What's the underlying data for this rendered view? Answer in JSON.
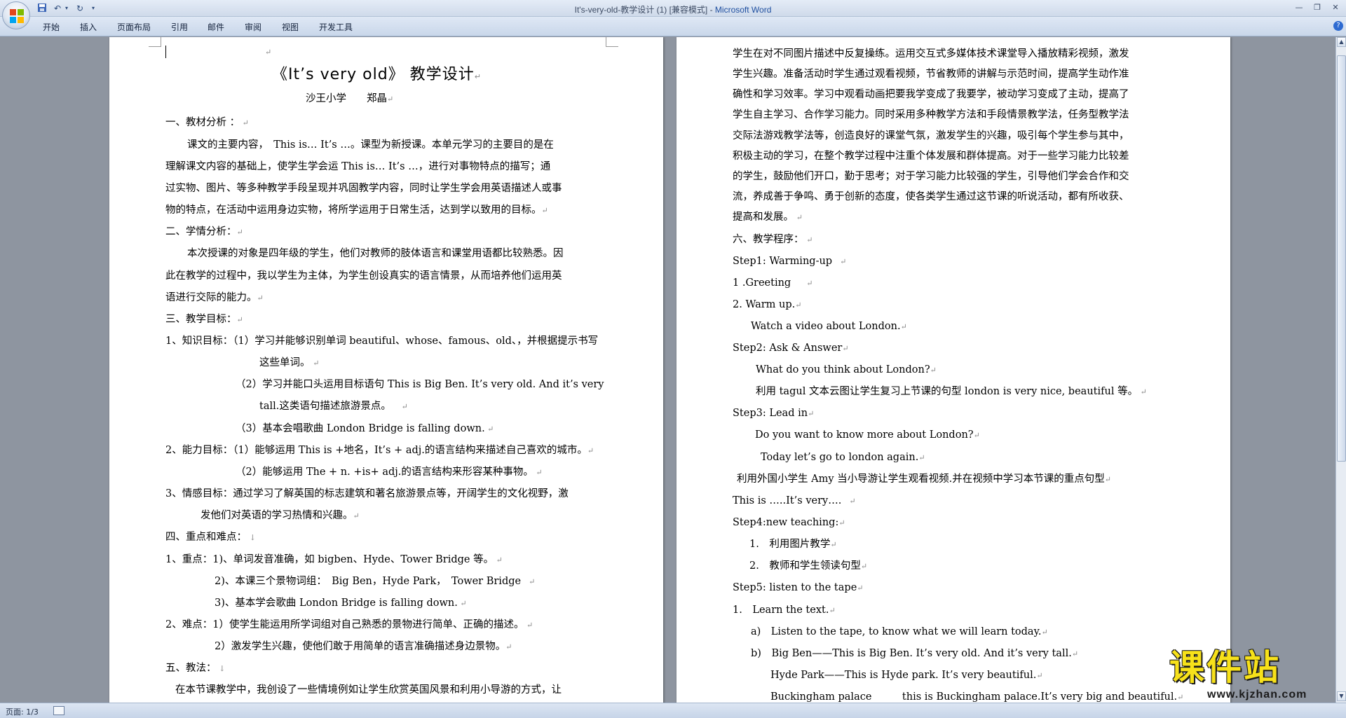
{
  "window": {
    "title": "It's-very-old-教学设计 (1) [兼容模式] - ",
    "app_name": "Microsoft Word"
  },
  "ribbon": {
    "tabs": [
      "开始",
      "插入",
      "页面布局",
      "引用",
      "邮件",
      "审阅",
      "视图",
      "开发工具"
    ]
  },
  "status": {
    "page": "页面: 1/3"
  },
  "watermark": {
    "brand": "课件站",
    "url": "www.kjzhan.com"
  },
  "left_page": {
    "title": "《It’s very old》 教学设计",
    "author": "沙王小学　　郑晶",
    "lines": [
      "一、教材分析 ：",
      "课文的主要内容，　This is… It’s …。课型为新授课。本单元学习的主要目的是在",
      "理解课文内容的基础上，使学生学会运 This is… It’s …，进行对事物特点的描写；通",
      "过实物、图片、等多种教学手段呈现并巩固教学内容，同时让学生学会用英语描述人或事",
      "物的特点，在活动中运用身边实物，将所学运用于日常生活，达到学以致用的目标。",
      "二、学情分析：",
      "本次授课的对象是四年级的学生，他们对教师的肢体语言和课堂用语都比较熟悉。因",
      "此在教学的过程中，我以学生为主体，为学生创设真实的语言情景，从而培养他们运用英",
      "语进行交际的能力。",
      "三、教学目标：",
      "1、知识目标：（1）学习并能够识别单词 beautiful、whose、famous、old、，并根据提示书写",
      "这些单词。",
      "（2）学习并能口头运用目标语句 This is Big Ben. It’s very old. And it’s very",
      "tall.这类语句描述旅游景点。",
      "（3）基本会唱歌曲 London Bridge is falling down.",
      "2、能力目标：（1）能够运用 This is +地名，It’s + adj.的语言结构来描述自己喜欢的城市。",
      "（2）能够运用 The + n. +is+ adj.的语言结构来形容某种事物。",
      "3、情感目标：通过学习了解英国的标志建筑和著名旅游景点等，开阔学生的文化视野，激",
      "发他们对英语的学习热情和兴趣。",
      "四、重点和难点：",
      "1、重点：1)、单词发音准确，如 bigben、Hyde、Tower Bridge 等。",
      "2)、本课三个景物词组：　Big Ben，Hyde Park，　Tower Bridge",
      "3)、基本学会歌曲 London Bridge is falling down.",
      "2、难点：1）使学生能运用所学词组对自己熟悉的景物进行简单、正确的描述。",
      "2）激发学生兴趣，使他们敢于用简单的语言准确描述身边景物。",
      "五、教法：",
      "在本节课教学中，我创设了一些情境例如让学生欣赏英国风景和利用小导游的方式，让"
    ]
  },
  "right_page": {
    "lines": [
      "学生在对不同图片描述中反复操练。运用交互式多媒体技术课堂导入播放精彩视频，激发",
      "学生兴趣。准备活动时学生通过观看视频，节省教师的讲解与示范时间，提高学生动作准",
      "确性和学习效率。学习中观看动画把要我学变成了我要学，被动学习变成了主动，提高了",
      "学生自主学习、合作学习能力。同时采用多种教学方法和手段情景教学法，任务型教学法",
      "交际法游戏教学法等，创造良好的课堂气氛，激发学生的兴趣，吸引每个学生参与其中，",
      "积极主动的学习，在整个教学过程中注重个体发展和群体提高。对于一些学习能力比较差",
      "的学生，鼓励他们开口，勤于思考；对于学习能力比较强的学生，引导他们学会合作和交",
      "流，养成善于争鸣、勇于创新的态度，使各类学生通过这节课的听说活动，都有所收获、",
      "提高和发展。",
      "六、教学程序：",
      "Step1: Warming-up",
      "1 .Greeting",
      "2. Warm up.",
      "Watch a video about London.",
      "Step2: Ask & Answer",
      "What do you think about London?",
      "利用 tagul 文本云图让学生复习上节课的句型 london is very nice, beautiful 等。",
      "Step3: Lead in",
      "Do you want to know more about London?",
      "Today let’s go to london again.",
      "利用外国小学生 Amy 当小导游让学生观看视频.并在视频中学习本节课的重点句型",
      "This is …..It’s very….",
      "Step4:new teaching:",
      "1.　利用图片教学",
      "2.　教师和学生领读句型",
      "Step5: listen to the tape",
      "1.　Learn the text.",
      "a)　Listen to the tape, to know what we will learn today.",
      "b)　Big Ben——This is Big Ben. It’s very old. And it’s very tall.",
      "Hyde Park——This is Hyde park. It’s very beautiful.",
      "Buckingham palace　　　this is Buckingham palace.It’s very big and beautiful."
    ]
  }
}
